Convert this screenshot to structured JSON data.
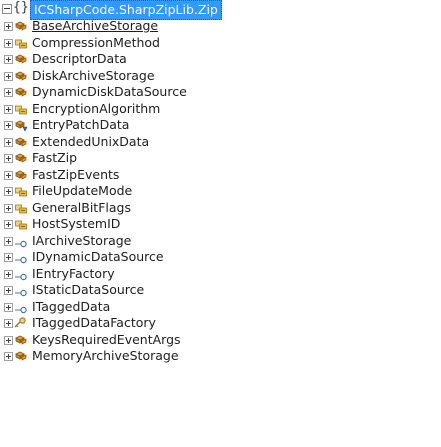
{
  "tree": {
    "root": {
      "label": "ICSharpCode.SharpZipLib.Zip",
      "icon": "namespace-icon"
    },
    "items": [
      {
        "label": "BaseArchiveStorage",
        "kind": "class"
      },
      {
        "label": "CompressionMethod",
        "kind": "enum"
      },
      {
        "label": "DescriptorData",
        "kind": "class"
      },
      {
        "label": "DiskArchiveStorage",
        "kind": "class"
      },
      {
        "label": "DynamicDiskDataSource",
        "kind": "class"
      },
      {
        "label": "EncryptionAlgorithm",
        "kind": "enum"
      },
      {
        "label": "EntryPatchData",
        "kind": "class-internal"
      },
      {
        "label": "ExtendedUnixData",
        "kind": "class"
      },
      {
        "label": "FastZip",
        "kind": "class"
      },
      {
        "label": "FastZipEvents",
        "kind": "class"
      },
      {
        "label": "FileUpdateMode",
        "kind": "enum"
      },
      {
        "label": "GeneralBitFlags",
        "kind": "enum"
      },
      {
        "label": "HostSystemID",
        "kind": "enum"
      },
      {
        "label": "IArchiveStorage",
        "kind": "interface"
      },
      {
        "label": "IDynamicDataSource",
        "kind": "interface"
      },
      {
        "label": "IEntryFactory",
        "kind": "interface"
      },
      {
        "label": "IStaticDataSource",
        "kind": "interface"
      },
      {
        "label": "ITaggedData",
        "kind": "interface"
      },
      {
        "label": "ITaggedDataFactory",
        "kind": "interface-key"
      },
      {
        "label": "KeysRequiredEventArgs",
        "kind": "class"
      },
      {
        "label": "MemoryArchiveStorage",
        "kind": "class"
      }
    ]
  },
  "colors": {
    "selection": "#3399ff",
    "class": "#b5730e",
    "enum": "#b08a2a",
    "interface": "#3a6db5"
  }
}
